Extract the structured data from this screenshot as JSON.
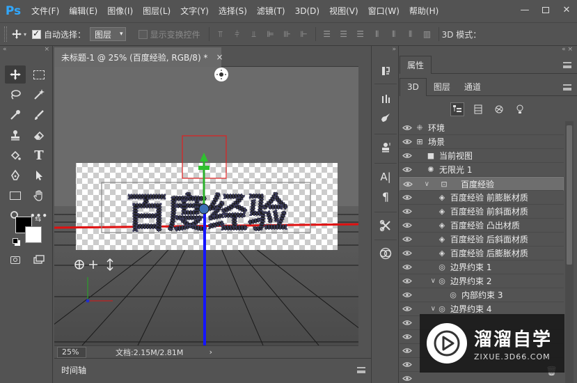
{
  "app": {
    "logo": "Ps"
  },
  "menubar": {
    "items": [
      "文件(F)",
      "编辑(E)",
      "图像(I)",
      "图层(L)",
      "文字(Y)",
      "选择(S)",
      "滤镜(T)",
      "3D(D)",
      "视图(V)",
      "窗口(W)",
      "帮助(H)"
    ],
    "window_controls": [
      "minimize-icon",
      "restore-icon",
      "close-icon"
    ]
  },
  "options": {
    "auto_select_label": "自动选择：",
    "auto_select_checked": true,
    "auto_select_value": "图层",
    "show_transform_label": "显示变换控件",
    "show_transform_checked": false,
    "mode_label": "3D 模式："
  },
  "document": {
    "tab_title": "未标题-1 @ 25% (百度经验, RGB/8) *",
    "close_symbol": "×",
    "zoom": "25%",
    "doc_info": "文档:2.15M/2.81M",
    "status_arrow": "›",
    "canvas_text": "百度经验"
  },
  "timeline": {
    "tab": "时间轴"
  },
  "properties": {
    "title": "属性"
  },
  "panel_tabs": [
    "3D",
    "图层",
    "通道"
  ],
  "filters": [
    "scene-filter-icon",
    "mesh-filter-icon",
    "material-filter-icon",
    "light-filter-icon"
  ],
  "scene_items": [
    {
      "label": "环境",
      "icon": "environment-icon",
      "indent": 0,
      "expander": ""
    },
    {
      "label": "场景",
      "icon": "scene-icon",
      "indent": 0,
      "expander": ""
    },
    {
      "label": "当前视图",
      "icon": "camera-icon",
      "indent": 1,
      "expander": ""
    },
    {
      "label": "无限光 1",
      "icon": "light-icon",
      "indent": 1,
      "expander": ""
    },
    {
      "label": "百度经验",
      "icon": "mesh-icon",
      "indent": 1,
      "expander": "∨",
      "selected": true
    },
    {
      "label": "百度经验 前膨胀材质",
      "icon": "material-icon",
      "indent": 2,
      "expander": ""
    },
    {
      "label": "百度经验 前斜面材质",
      "icon": "material-icon",
      "indent": 2,
      "expander": ""
    },
    {
      "label": "百度经验 凸出材质",
      "icon": "material-icon",
      "indent": 2,
      "expander": ""
    },
    {
      "label": "百度经验 后斜面材质",
      "icon": "material-icon",
      "indent": 2,
      "expander": ""
    },
    {
      "label": "百度经验 后膨胀材质",
      "icon": "material-icon",
      "indent": 2,
      "expander": ""
    },
    {
      "label": "边界约束 1",
      "icon": "constraint-icon",
      "indent": 2,
      "expander": ""
    },
    {
      "label": "边界约束 2",
      "icon": "constraint-icon",
      "indent": 2,
      "expander": "∨"
    },
    {
      "label": "内部约束 3",
      "icon": "constraint-icon",
      "indent": 3,
      "expander": ""
    },
    {
      "label": "边界约束 4",
      "icon": "constraint-icon",
      "indent": 2,
      "expander": "∨"
    }
  ],
  "watermark": {
    "title": "溜溜自学",
    "url": "ZIXUE.3D66.COM"
  }
}
